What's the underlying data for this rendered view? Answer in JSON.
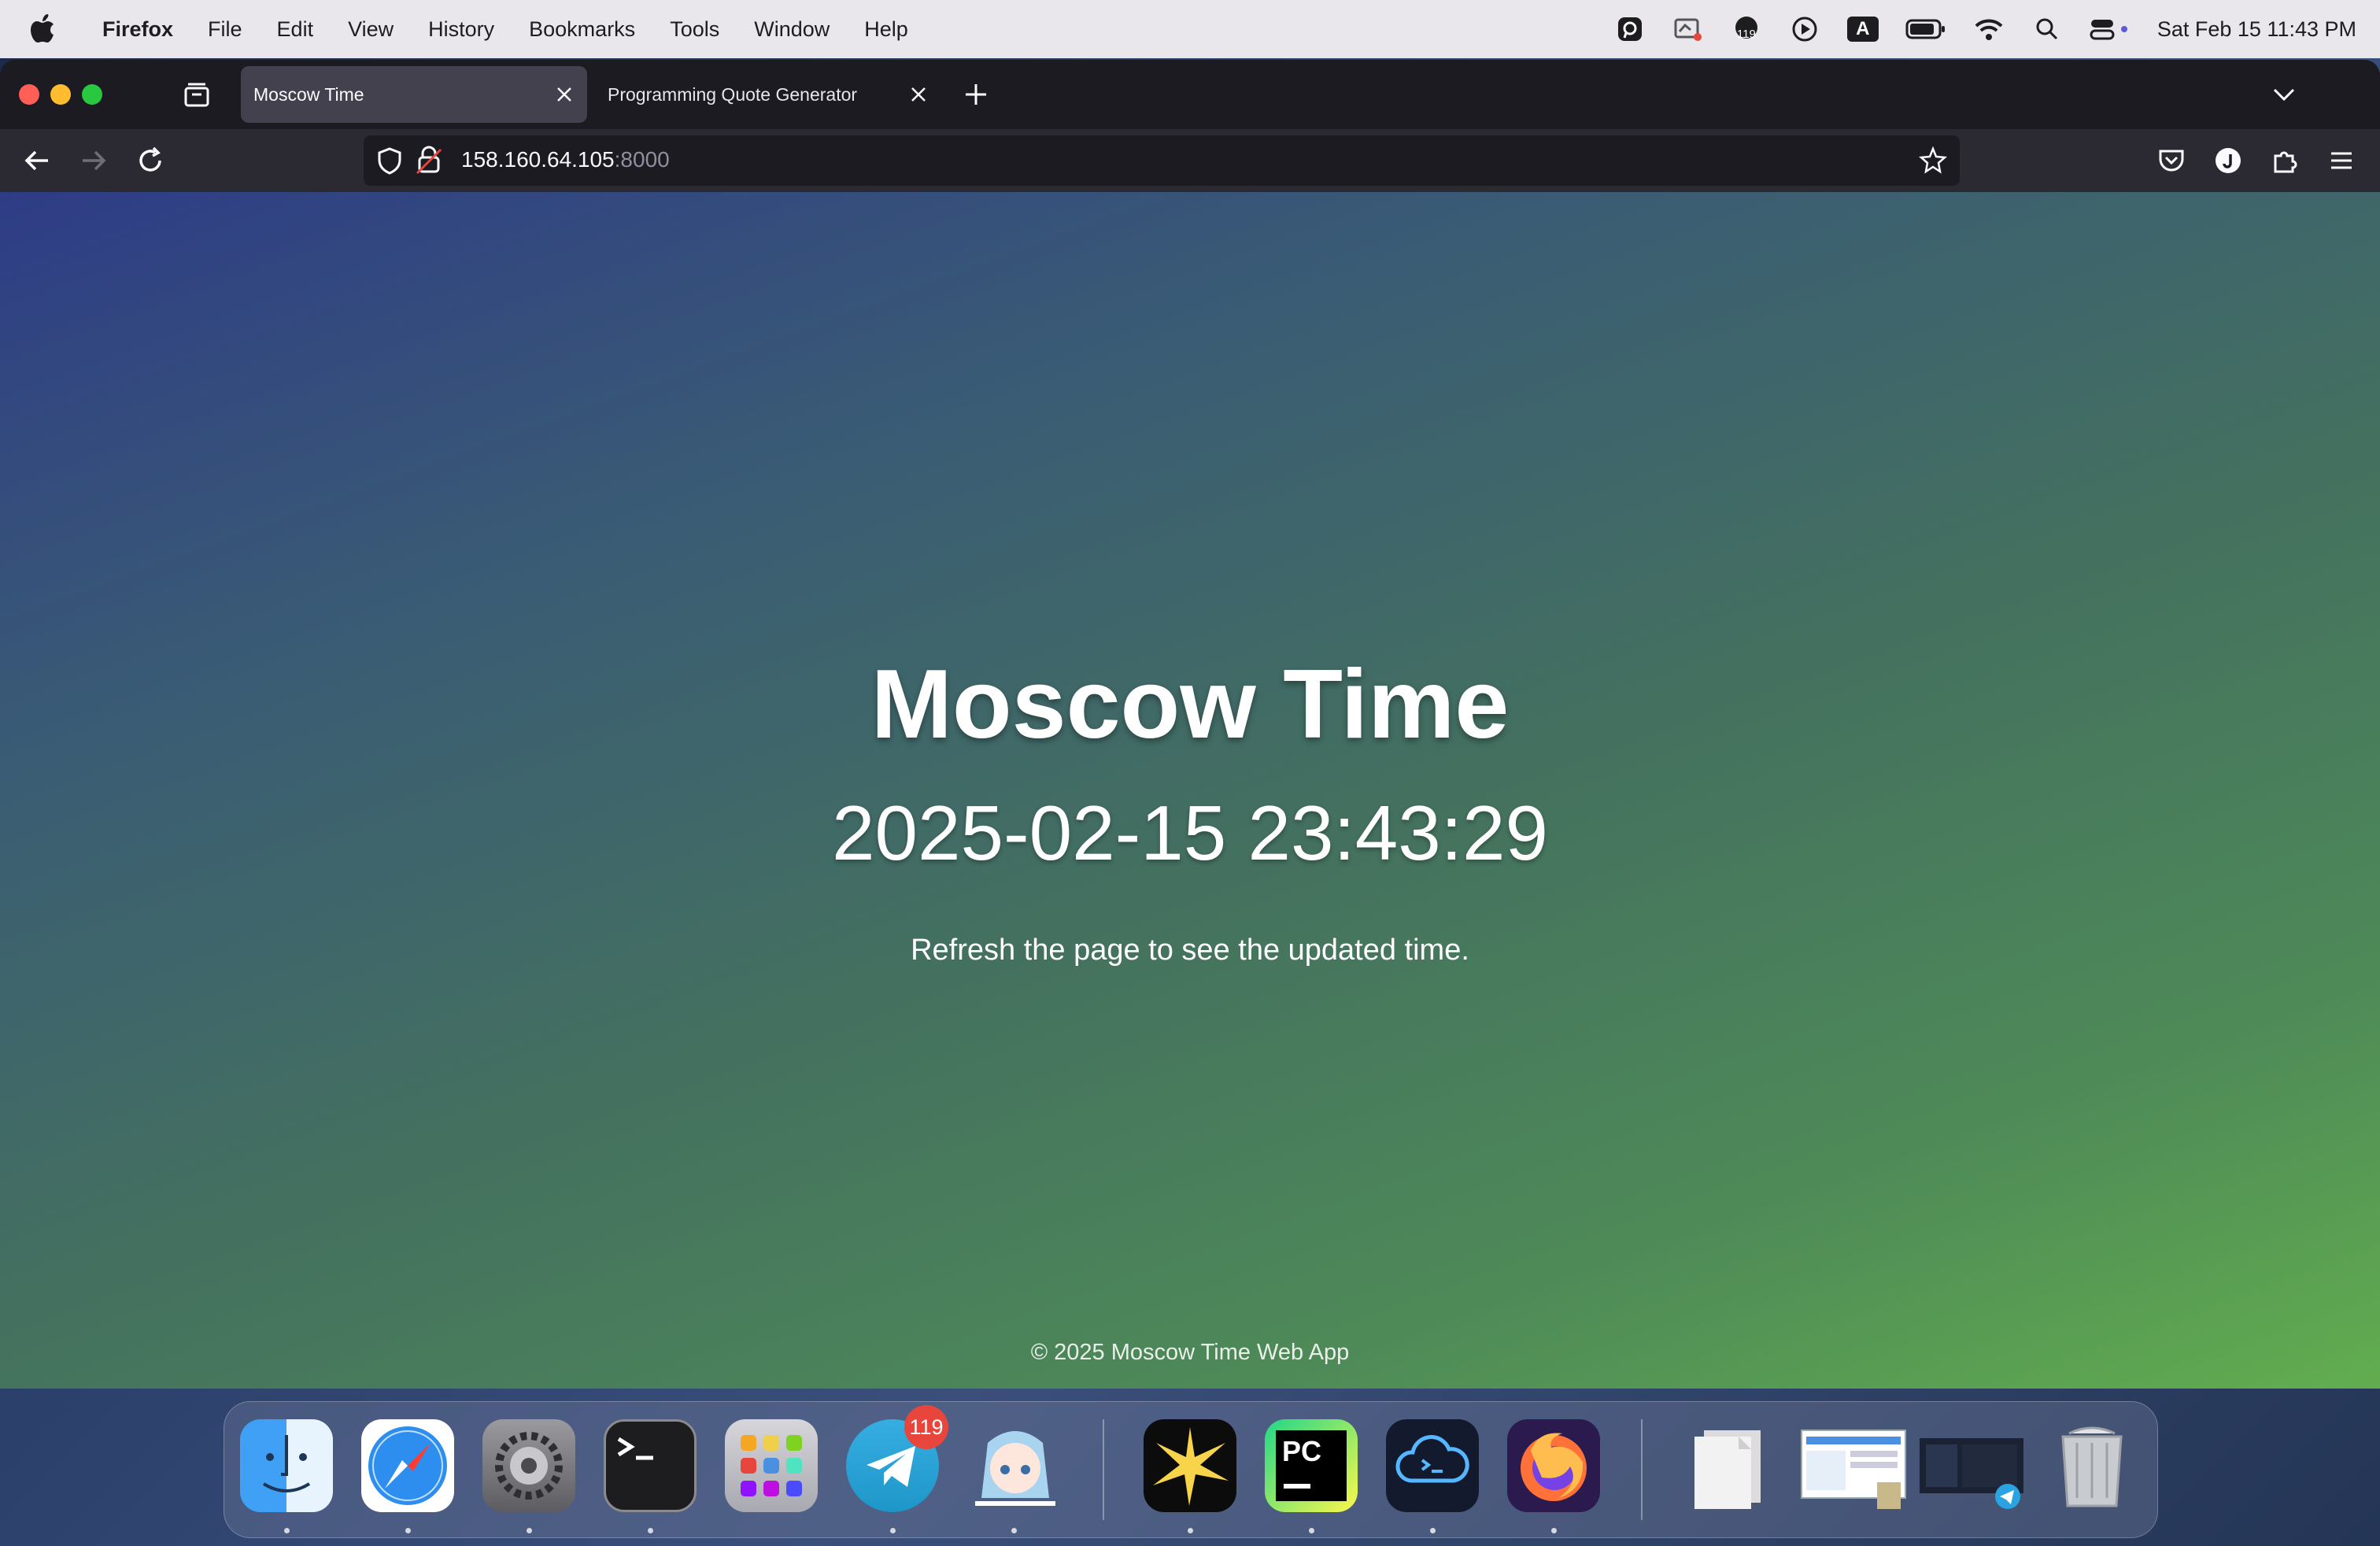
{
  "menubar": {
    "app_name": "Firefox",
    "items": [
      "File",
      "Edit",
      "View",
      "History",
      "Bookmarks",
      "Tools",
      "Window",
      "Help"
    ],
    "status_icons": [
      "pastebot-icon",
      "screen-share-icon",
      "notification-counter-icon",
      "play-icon",
      "input-source-icon",
      "battery-icon",
      "wifi-icon",
      "spotlight-search-icon",
      "control-center-icon"
    ],
    "status_badge": "119",
    "input_source": "A",
    "clock": "Sat Feb 15  11:43 PM"
  },
  "tabs": [
    {
      "label": "Moscow Time",
      "active": true
    },
    {
      "label": "Programming Quote Generator",
      "active": false
    }
  ],
  "address": {
    "host": "158.160.64.105",
    "port": ":8000"
  },
  "page": {
    "title": "Moscow Time",
    "time": "2025-02-15 23:43:29",
    "note": "Refresh the page to see the updated time.",
    "footer": "© 2025 Moscow Time Web App"
  },
  "dock": {
    "apps": [
      "finder",
      "safari",
      "system-settings",
      "terminal",
      "launchpad",
      "telegram",
      "anime-avatar-app",
      "spark-app",
      "pycharm",
      "cloud-terminal-app",
      "firefox"
    ],
    "telegram_badge": "119",
    "recent": [
      "documents-stack",
      "screenshot-stack",
      "telegram-window-stack",
      "trash"
    ],
    "pycharm_label": "PC"
  },
  "colors": {
    "accent_red": "#ff5f57",
    "accent_yellow": "#febc2e",
    "accent_green": "#28c840",
    "page_gradient_start": "#2e3c86",
    "page_gradient_end": "#62ad4f"
  }
}
